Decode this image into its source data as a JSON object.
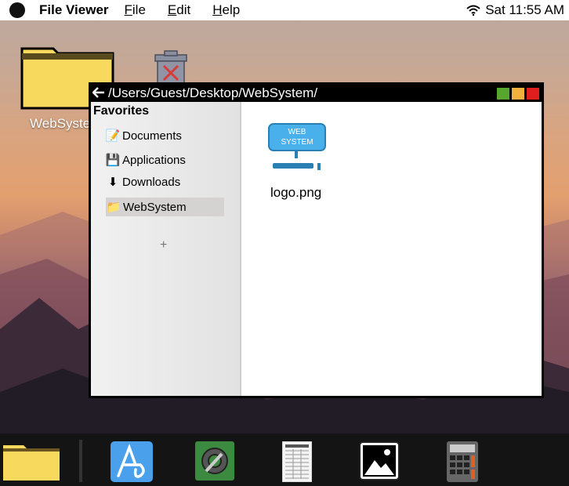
{
  "menubar": {
    "app_name": "File Viewer",
    "menus": [
      {
        "label": "File",
        "mnemonic": "F",
        "rest": "ile"
      },
      {
        "label": "Edit",
        "mnemonic": "E",
        "rest": "dit"
      },
      {
        "label": "Help",
        "mnemonic": "H",
        "rest": "elp"
      }
    ],
    "clock": "Sat 11:55 AM"
  },
  "desktop": {
    "folder_label": "WebSystem"
  },
  "window": {
    "path": "/Users/Guest/Desktop/WebSystem/",
    "buttons": [
      "maximize-button",
      "minimize-button",
      "close-button"
    ],
    "colors": {
      "green": "#56a62f",
      "yellow": "#f2b13c",
      "red": "#e01e1e"
    }
  },
  "sidebar": {
    "title": "Favorites",
    "items": [
      {
        "label": "Documents",
        "icon": "documents-icon"
      },
      {
        "label": "Applications",
        "icon": "floppy-disk-icon"
      },
      {
        "label": "Downloads",
        "icon": "download-arrow-icon"
      },
      {
        "label": "WebSystem",
        "icon": "folder-icon",
        "selected": true
      }
    ],
    "add_label": "+"
  },
  "content": {
    "files": [
      {
        "name": "logo.png",
        "icon_text_1": "WEB",
        "icon_text_2": "SYSTEM"
      }
    ]
  },
  "dock": {
    "items": [
      "folder-icon",
      "text-editor-icon",
      "settings-icon",
      "spreadsheet-icon",
      "image-viewer-icon",
      "calculator-icon"
    ]
  }
}
